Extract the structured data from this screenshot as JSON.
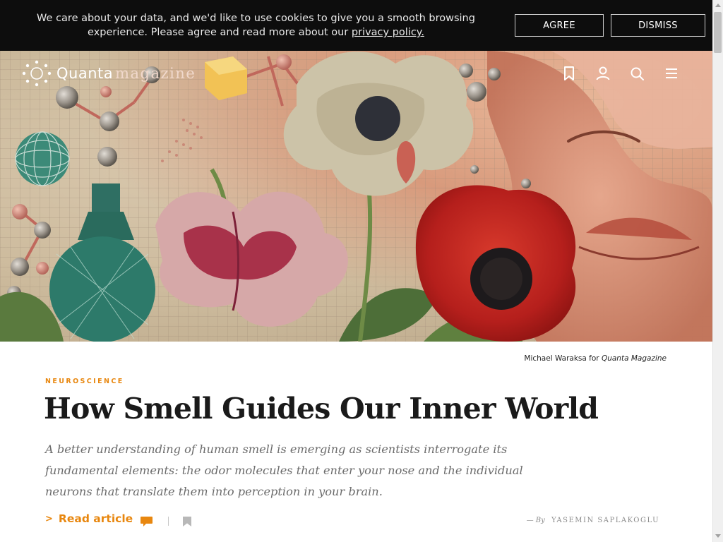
{
  "cookie_banner": {
    "text": "We care about your data, and we'd like to use cookies to give you a smooth browsing experience. Please agree and read more about our ",
    "link_text": "privacy policy.",
    "agree_label": "AGREE",
    "dismiss_label": "DISMISS"
  },
  "header": {
    "logo_word1": "Quanta",
    "logo_word2": "magazine",
    "icons": [
      "bookmark-icon",
      "user-icon",
      "search-icon",
      "menu-icon"
    ]
  },
  "hero": {
    "credit_prefix": "Michael Waraksa for ",
    "credit_italic": "Quanta Magazine"
  },
  "article": {
    "category": "NEUROSCIENCE",
    "title": "How Smell Guides Our Inner World",
    "dek": "A better understanding of human smell is emerging as scientists interrogate its fundamental elements: the odor molecules that enter your nose and the individual neurons that translate them into perception in your brain.",
    "read_label": "Read article",
    "byline_prefix": "— By",
    "author": "YASEMIN SAPLAKOGLU"
  },
  "colors": {
    "accent": "#e8870f",
    "banner_bg": "#0d0d0d",
    "headline": "#1a1a1a"
  }
}
